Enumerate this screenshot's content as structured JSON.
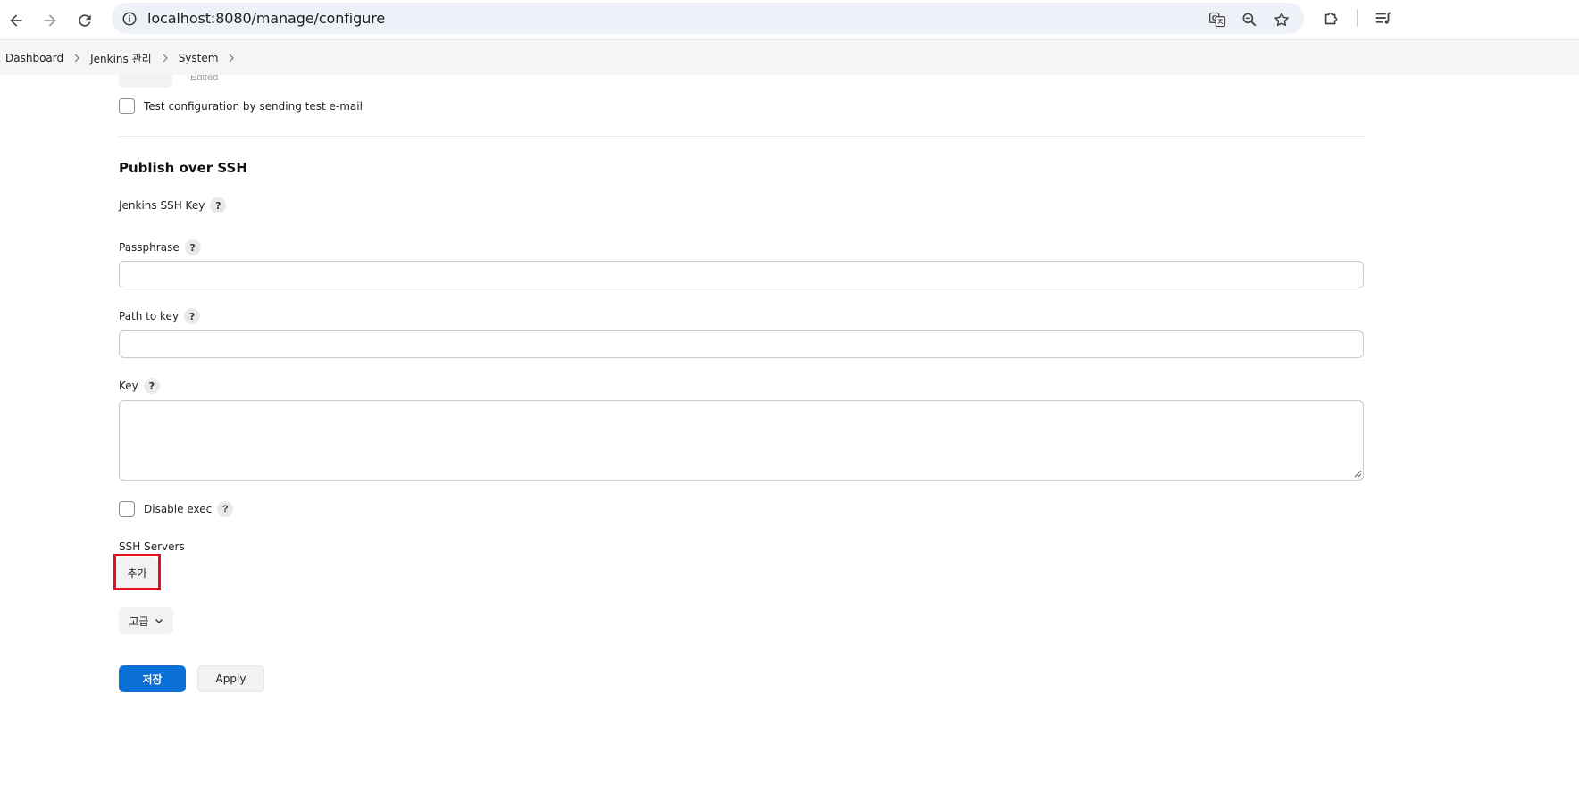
{
  "browser": {
    "url": "localhost:8080/manage/configure",
    "icons": {
      "back": "arrow-left-icon",
      "forward": "arrow-right-icon",
      "reload": "reload-icon",
      "site_info": "info-icon",
      "translate": "translate-icon",
      "zoom": "zoom-icon",
      "bookmark": "star-icon",
      "extensions": "puzzle-icon",
      "media": "media-queue-icon"
    }
  },
  "breadcrumb": {
    "items": [
      "Dashboard",
      "Jenkins 관리",
      "System"
    ]
  },
  "top_partial": {
    "edited_label": "Edited"
  },
  "email": {
    "test_config_label": "Test configuration by sending test e-mail"
  },
  "section": {
    "title": "Publish over SSH",
    "jenkins_ssh_key_label": "Jenkins SSH Key",
    "passphrase_label": "Passphrase",
    "passphrase_value": "",
    "path_to_key_label": "Path to key",
    "path_to_key_value": "",
    "key_label": "Key",
    "key_value": "",
    "disable_exec_label": "Disable exec",
    "ssh_servers_label": "SSH Servers",
    "add_button_label": "추가",
    "advanced_button_label": "고급",
    "help_symbol": "?"
  },
  "footer": {
    "save_label": "저장",
    "apply_label": "Apply"
  },
  "colors": {
    "primary": "#0b6fd8",
    "highlight": "#e3101e",
    "breadcrumb_bg": "#f5f5f6"
  }
}
